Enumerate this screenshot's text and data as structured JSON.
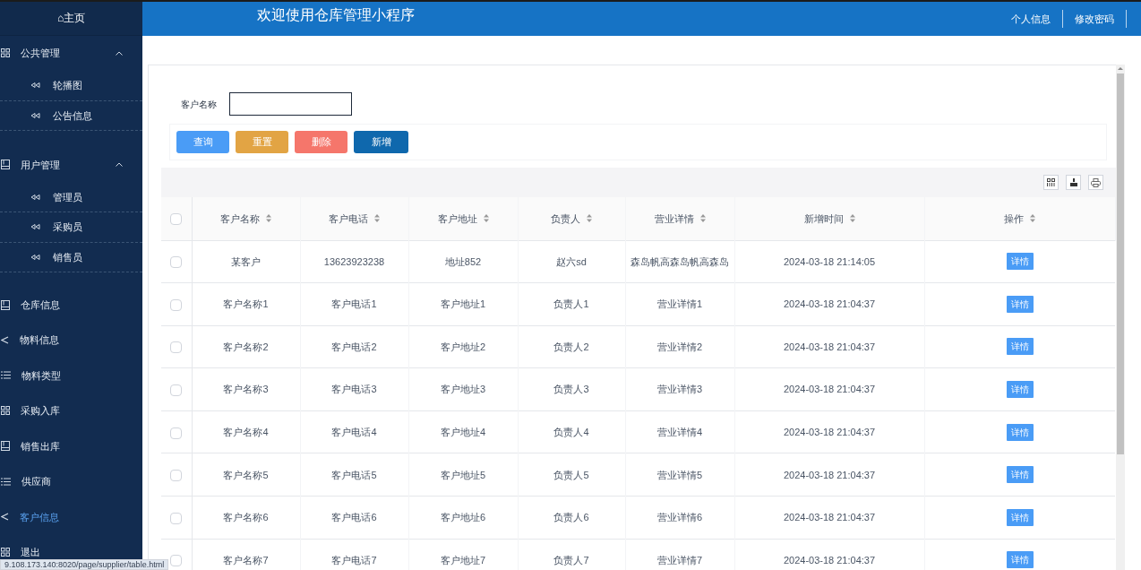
{
  "sidebar": {
    "home": "⌂主页",
    "items": [
      {
        "label": "公共管理",
        "kind": "grid",
        "expanded": true,
        "selected": false,
        "children": [
          {
            "label": "轮播图",
            "selected": false
          },
          {
            "label": "公告信息",
            "selected": false
          }
        ]
      },
      {
        "label": "用户管理",
        "kind": "book",
        "expanded": true,
        "selected": false,
        "children": [
          {
            "label": "管理员",
            "selected": false
          },
          {
            "label": "采购员",
            "selected": false
          },
          {
            "label": "销售员",
            "selected": false
          }
        ]
      },
      {
        "label": "仓库信息",
        "kind": "book",
        "selected": false
      },
      {
        "label": "物料信息",
        "kind": "share",
        "selected": false
      },
      {
        "label": "物料类型",
        "kind": "list",
        "selected": false
      },
      {
        "label": "采购入库",
        "kind": "grid",
        "selected": false
      },
      {
        "label": "销售出库",
        "kind": "book",
        "selected": false
      },
      {
        "label": "供应商",
        "kind": "list",
        "selected": false
      },
      {
        "label": "客户信息",
        "kind": "share",
        "selected": true
      },
      {
        "label": "退出",
        "kind": "grid",
        "selected": false
      }
    ]
  },
  "header": {
    "title": "欢迎使用仓库管理小程序",
    "links": [
      "个人信息",
      "修改密码"
    ]
  },
  "search": {
    "label": "客户名称"
  },
  "buttons": [
    {
      "label": "查询",
      "kind": "query"
    },
    {
      "label": "重置",
      "kind": "reset"
    },
    {
      "label": "删除",
      "kind": "delete"
    },
    {
      "label": "新增",
      "kind": "add"
    }
  ],
  "table": {
    "all_checked": false,
    "columns": [
      "客户名称",
      "客户电话",
      "客户地址",
      "负责人",
      "营业详情",
      "新增时间",
      "操作"
    ],
    "rows": [
      {
        "checked": false,
        "cells": [
          "某客户",
          "13623923238",
          "地址852",
          "赵六sd",
          "森岛帆高森岛帆高森岛",
          "2024-03-18 21:14:05"
        ],
        "action": "详情"
      },
      {
        "checked": false,
        "cells": [
          "客户名称1",
          "客户电话1",
          "客户地址1",
          "负责人1",
          "营业详情1",
          "2024-03-18 21:04:37"
        ],
        "action": "详情"
      },
      {
        "checked": false,
        "cells": [
          "客户名称2",
          "客户电话2",
          "客户地址2",
          "负责人2",
          "营业详情2",
          "2024-03-18 21:04:37"
        ],
        "action": "详情"
      },
      {
        "checked": false,
        "cells": [
          "客户名称3",
          "客户电话3",
          "客户地址3",
          "负责人3",
          "营业详情3",
          "2024-03-18 21:04:37"
        ],
        "action": "详情"
      },
      {
        "checked": false,
        "cells": [
          "客户名称4",
          "客户电话4",
          "客户地址4",
          "负责人4",
          "营业详情4",
          "2024-03-18 21:04:37"
        ],
        "action": "详情"
      },
      {
        "checked": false,
        "cells": [
          "客户名称5",
          "客户电话5",
          "客户地址5",
          "负责人5",
          "营业详情5",
          "2024-03-18 21:04:37"
        ],
        "action": "详情"
      },
      {
        "checked": false,
        "cells": [
          "客户名称6",
          "客户电话6",
          "客户地址6",
          "负责人6",
          "营业详情6",
          "2024-03-18 21:04:37"
        ],
        "action": "详情"
      },
      {
        "checked": false,
        "cells": [
          "客户名称7",
          "客户电话7",
          "客户地址7",
          "负责人7",
          "营业详情7",
          "2024-03-18 21:04:37"
        ],
        "action": "详情"
      }
    ]
  },
  "status_url": "9.108.173.140:8020/page/supplier/table.html"
}
